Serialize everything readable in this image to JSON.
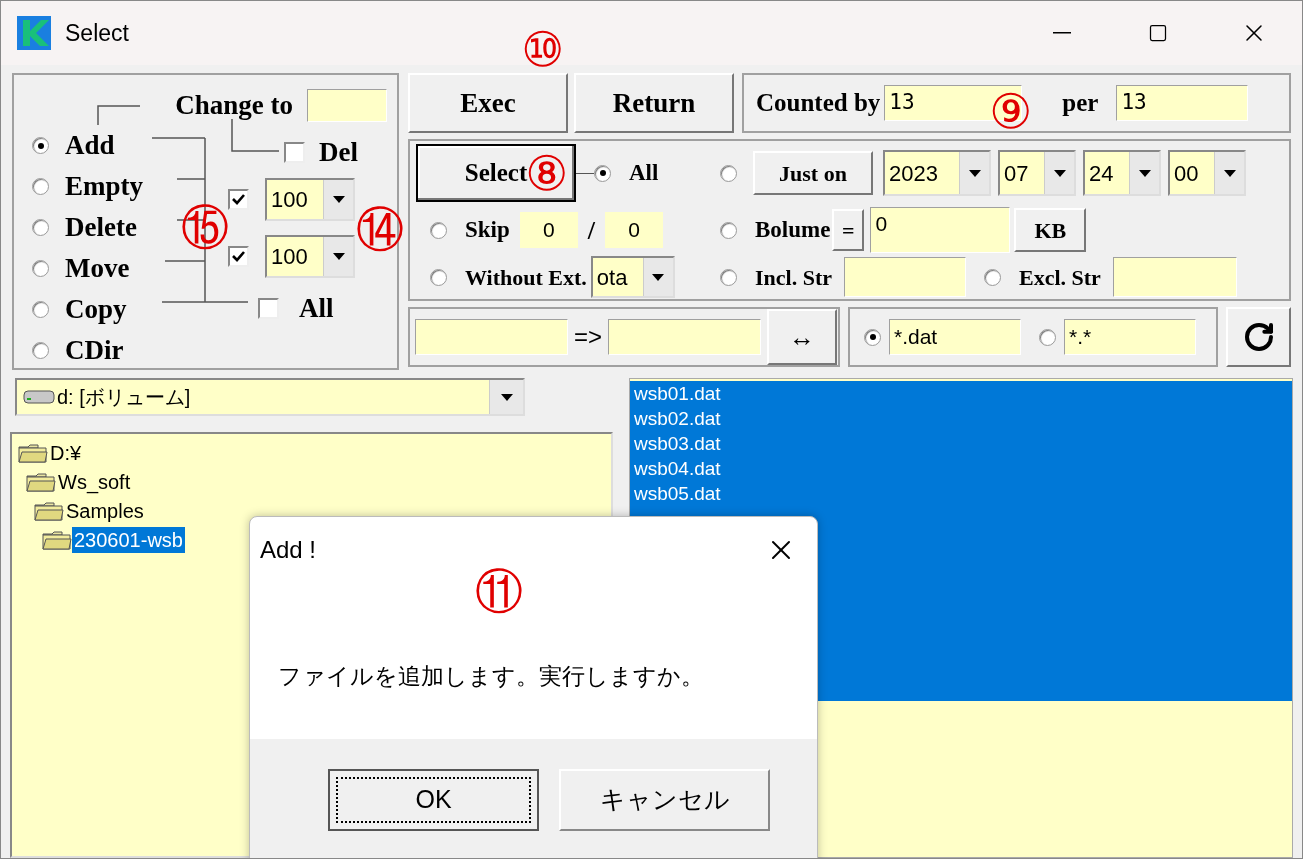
{
  "window": {
    "title": "Select"
  },
  "mode_panel": {
    "change_to": {
      "label": "Change to"
    },
    "modes": [
      {
        "label": "Add",
        "selected": true
      },
      {
        "label": "Empty",
        "selected": false
      },
      {
        "label": "Delete",
        "selected": false
      },
      {
        "label": "Move",
        "selected": false
      },
      {
        "label": "Copy",
        "selected": false
      },
      {
        "label": "CDir",
        "selected": false
      }
    ],
    "del": {
      "label": "Del",
      "checked": false
    },
    "limits": [
      {
        "checked": true,
        "value": "100"
      },
      {
        "checked": true,
        "value": "100"
      }
    ],
    "all": {
      "label": "All",
      "checked": false
    }
  },
  "actions": [
    {
      "label": "Exec"
    },
    {
      "label": "Return"
    }
  ],
  "counter": {
    "label": "Counted by",
    "value": "13",
    "per_label": "per",
    "per_value": "13"
  },
  "select_panel": {
    "button": "Select",
    "all": {
      "label": "All",
      "selected": true
    },
    "just_on": {
      "selected": false,
      "button": "Just on",
      "date": [
        "2023",
        "07",
        "24",
        "00"
      ]
    },
    "skip": {
      "label": "Skip",
      "selected": false,
      "from": "0",
      "separator": "/",
      "to": "0"
    },
    "volume": {
      "label": "Bolume",
      "selected": false,
      "operator": "=",
      "value": "0",
      "unit": "KB"
    },
    "without_ext": {
      "label": "Without Ext.",
      "selected": false,
      "value": "ota"
    },
    "incl": {
      "label": "Incl. Str",
      "selected": false
    },
    "excl": {
      "label": "Excl. Str",
      "selected": false
    }
  },
  "rename": {
    "arrow": "=>",
    "swap": "↔"
  },
  "patterns": [
    {
      "value": "*.dat",
      "selected": true
    },
    {
      "value": "*.*",
      "selected": false
    }
  ],
  "drive": {
    "value": "d: [ボリューム]"
  },
  "tree": [
    {
      "label": "D:¥",
      "selected": false,
      "children": [
        {
          "label": "Ws_soft",
          "selected": false,
          "children": [
            {
              "label": "Samples",
              "selected": false,
              "children": [
                {
                  "label": "230601-wsb",
                  "selected": true
                }
              ]
            }
          ]
        }
      ]
    }
  ],
  "files": [
    {
      "name": "wsb01.dat",
      "selected": true
    },
    {
      "name": "wsb02.dat",
      "selected": true
    },
    {
      "name": "wsb03.dat",
      "selected": true
    },
    {
      "name": "wsb04.dat",
      "selected": true
    },
    {
      "name": "wsb05.dat",
      "selected": true
    }
  ],
  "dialog": {
    "title": "Add !",
    "message": "ファイルを追加します。実行しますか。",
    "buttons": [
      {
        "label": "OK",
        "default": true
      },
      {
        "label": "キャンセル",
        "default": false
      }
    ]
  },
  "callouts": [
    "⑩",
    "⑨",
    "⑧",
    "⑮",
    "⑭",
    "⑪"
  ]
}
